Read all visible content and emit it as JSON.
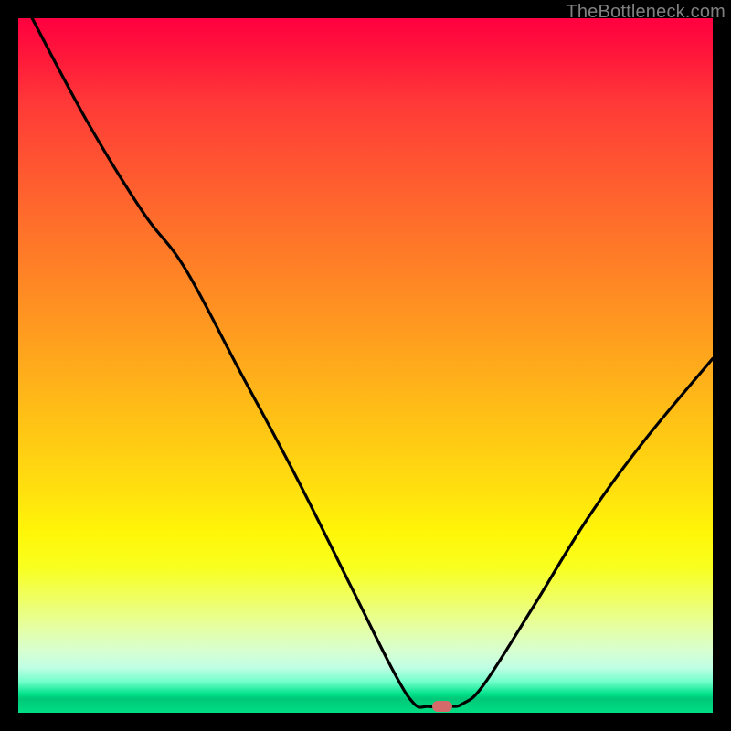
{
  "watermark": "TheBottleneck.com",
  "chart_data": {
    "type": "line",
    "title": "",
    "xlabel": "",
    "ylabel": "",
    "xlim": [
      0,
      100
    ],
    "ylim": [
      0,
      100
    ],
    "grid": false,
    "legend": false,
    "series": [
      {
        "name": "bottleneck-curve",
        "color": "#000000",
        "points": [
          {
            "x": 2,
            "y": 100
          },
          {
            "x": 10,
            "y": 85
          },
          {
            "x": 18,
            "y": 72
          },
          {
            "x": 24,
            "y": 64
          },
          {
            "x": 32,
            "y": 49
          },
          {
            "x": 40,
            "y": 34
          },
          {
            "x": 48,
            "y": 18
          },
          {
            "x": 54,
            "y": 6
          },
          {
            "x": 57,
            "y": 1.3
          },
          {
            "x": 59,
            "y": 0.9
          },
          {
            "x": 62,
            "y": 0.9
          },
          {
            "x": 64,
            "y": 1.3
          },
          {
            "x": 67,
            "y": 4
          },
          {
            "x": 74,
            "y": 15
          },
          {
            "x": 82,
            "y": 28
          },
          {
            "x": 90,
            "y": 39
          },
          {
            "x": 100,
            "y": 51
          }
        ]
      }
    ],
    "marker": {
      "x": 61,
      "y": 0.9,
      "color": "#d46a6a"
    },
    "background_gradient": {
      "top": "#ff0040",
      "mid": "#ffe00e",
      "bottom": "#00de84"
    }
  }
}
